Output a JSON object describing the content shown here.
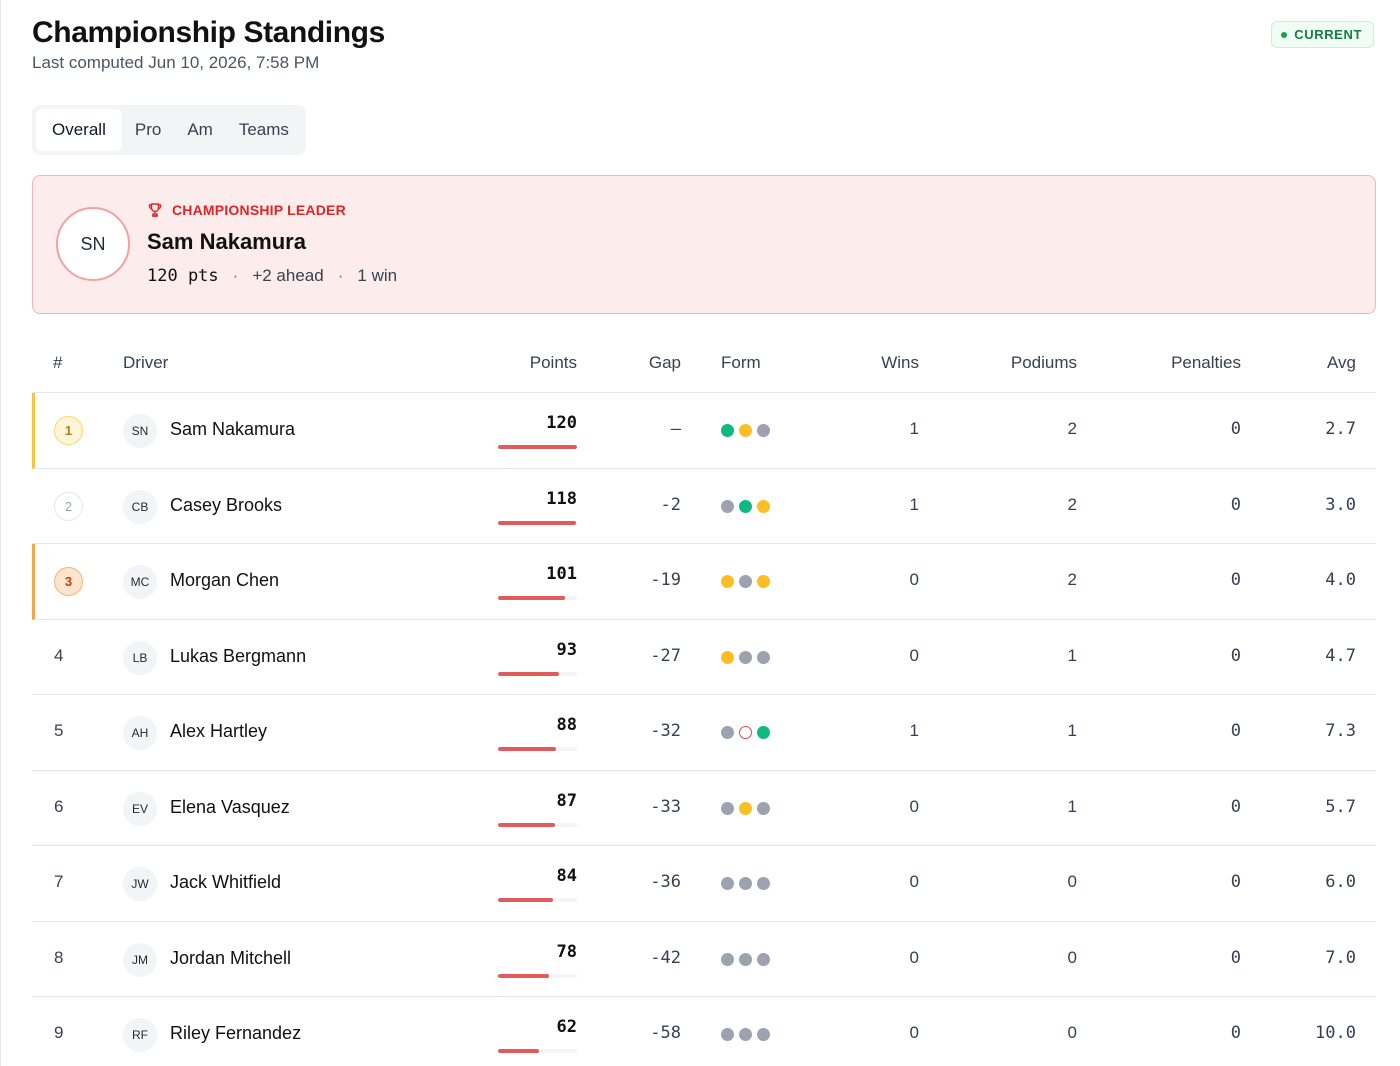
{
  "header": {
    "title": "Championship Standings",
    "subtitle": "Last computed Jun 10, 2026, 7:58 PM",
    "status": "CURRENT"
  },
  "tabs": [
    "Overall",
    "Pro",
    "Am",
    "Teams"
  ],
  "active_tab": "Overall",
  "leader": {
    "kicker": "CHAMPIONSHIP LEADER",
    "initials": "SN",
    "name": "Sam Nakamura",
    "points": "120 pts",
    "ahead": "+2 ahead",
    "wins": "1 win"
  },
  "columns": {
    "pos": "#",
    "driver": "Driver",
    "points": "Points",
    "gap": "Gap",
    "form": "Form",
    "wins": "Wins",
    "podiums": "Podiums",
    "penalties": "Penalties",
    "avg": "Avg"
  },
  "form_legend_colors": {
    "win": "#10b981",
    "podium": "#fbbf24",
    "finish": "#9ca3af",
    "dnf": "#ef4444"
  },
  "standings": [
    {
      "pos": "1",
      "initials": "SN",
      "name": "Sam Nakamura",
      "points": "120",
      "points_fraction": 1.0,
      "gap": "—",
      "form": [
        "win",
        "podium",
        "finish"
      ],
      "wins": "1",
      "podiums": "2",
      "penalties": "0",
      "avg": "2.7"
    },
    {
      "pos": "2",
      "initials": "CB",
      "name": "Casey Brooks",
      "points": "118",
      "points_fraction": 0.983,
      "gap": "-2",
      "form": [
        "finish",
        "win",
        "podium"
      ],
      "wins": "1",
      "podiums": "2",
      "penalties": "0",
      "avg": "3.0"
    },
    {
      "pos": "3",
      "initials": "MC",
      "name": "Morgan Chen",
      "points": "101",
      "points_fraction": 0.842,
      "gap": "-19",
      "form": [
        "podium",
        "finish",
        "podium"
      ],
      "wins": "0",
      "podiums": "2",
      "penalties": "0",
      "avg": "4.0"
    },
    {
      "pos": "4",
      "initials": "LB",
      "name": "Lukas Bergmann",
      "points": "93",
      "points_fraction": 0.775,
      "gap": "-27",
      "form": [
        "podium",
        "finish",
        "finish"
      ],
      "wins": "0",
      "podiums": "1",
      "penalties": "0",
      "avg": "4.7"
    },
    {
      "pos": "5",
      "initials": "AH",
      "name": "Alex Hartley",
      "points": "88",
      "points_fraction": 0.733,
      "gap": "-32",
      "form": [
        "finish",
        "dnf",
        "win"
      ],
      "wins": "1",
      "podiums": "1",
      "penalties": "0",
      "avg": "7.3"
    },
    {
      "pos": "6",
      "initials": "EV",
      "name": "Elena Vasquez",
      "points": "87",
      "points_fraction": 0.725,
      "gap": "-33",
      "form": [
        "finish",
        "podium",
        "finish"
      ],
      "wins": "0",
      "podiums": "1",
      "penalties": "0",
      "avg": "5.7"
    },
    {
      "pos": "7",
      "initials": "JW",
      "name": "Jack Whitfield",
      "points": "84",
      "points_fraction": 0.7,
      "gap": "-36",
      "form": [
        "finish",
        "finish",
        "finish"
      ],
      "wins": "0",
      "podiums": "0",
      "penalties": "0",
      "avg": "6.0"
    },
    {
      "pos": "8",
      "initials": "JM",
      "name": "Jordan Mitchell",
      "points": "78",
      "points_fraction": 0.65,
      "gap": "-42",
      "form": [
        "finish",
        "finish",
        "finish"
      ],
      "wins": "0",
      "podiums": "0",
      "penalties": "0",
      "avg": "7.0"
    },
    {
      "pos": "9",
      "initials": "RF",
      "name": "Riley Fernandez",
      "points": "62",
      "points_fraction": 0.517,
      "gap": "-58",
      "form": [
        "finish",
        "finish",
        "finish"
      ],
      "wins": "0",
      "podiums": "0",
      "penalties": "0",
      "avg": "10.0"
    }
  ]
}
